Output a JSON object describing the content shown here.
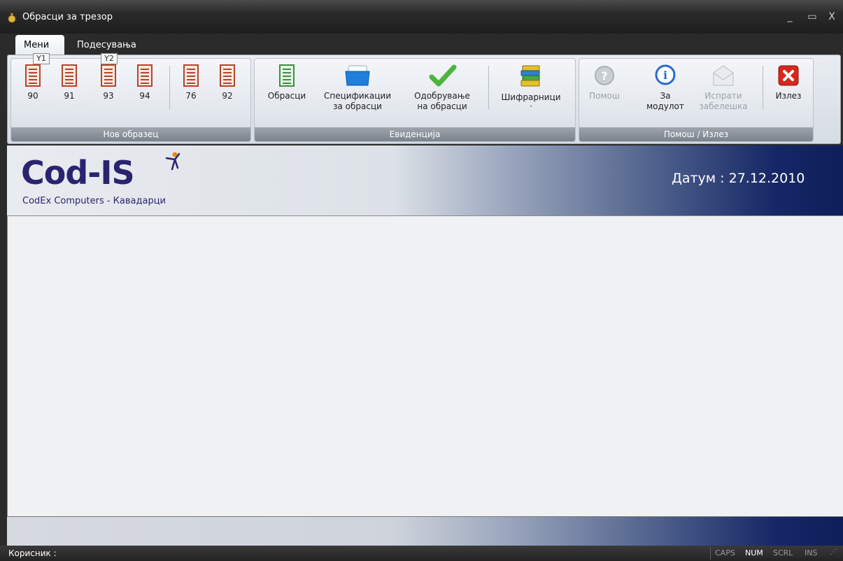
{
  "window": {
    "title": "Обрасци за трезор",
    "minimize": "_",
    "maximize": "▭",
    "close": "X"
  },
  "tabs": [
    {
      "label": "Мени",
      "active": true
    },
    {
      "label": "Подесувања",
      "active": false
    }
  ],
  "keytips": [
    "Y1",
    "Y2"
  ],
  "ribbon": {
    "groups": [
      {
        "label": "Нов образец",
        "buttons": [
          "90",
          "91",
          "93",
          "94",
          "76",
          "92"
        ]
      },
      {
        "label": "Евиденција",
        "buttons": [
          {
            "line1": "Обрасци",
            "line2": ""
          },
          {
            "line1": "Спецификации",
            "line2": "за обрасци"
          },
          {
            "line1": "Одобрување",
            "line2": "на обрасци"
          },
          {
            "line1": "Шифрарници",
            "line2": "˅"
          }
        ]
      },
      {
        "label": "Помош / Излез",
        "buttons": [
          {
            "line1": "Помош",
            "line2": "",
            "enabled": false
          },
          {
            "line1": "За",
            "line2": "модулот",
            "enabled": true
          },
          {
            "line1": "Испрати",
            "line2": "забелешка",
            "enabled": false
          },
          {
            "line1": "Излез",
            "line2": "",
            "enabled": true
          }
        ]
      }
    ]
  },
  "banner": {
    "logo": "Cod-IS",
    "subtitle": "CodEx Computers - Кавадарци",
    "date": "Датум : 27.12.2010"
  },
  "status": {
    "user": "Корисник :",
    "indicators": [
      "CAPS",
      "NUM",
      "SCRL",
      "INS"
    ],
    "active_indicator": "NUM"
  },
  "colors": {
    "doc_icon": "#b2452b",
    "green_doc_icon": "#3f8f3f",
    "banner_dark": "#0e1e5a",
    "logo": "#2a2470",
    "exit_red": "#d9261c"
  }
}
